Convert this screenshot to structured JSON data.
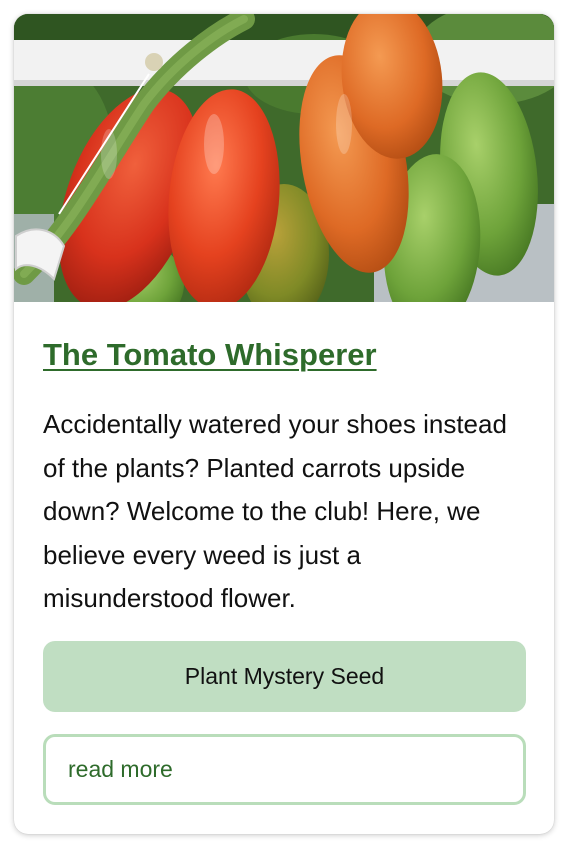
{
  "card": {
    "image_alt": "Elongated tomatoes ripening on the vine",
    "title": "The Tomato Whisperer",
    "description": "Accidentally watered your shoes instead of the plants? Planted carrots upside down? Welcome to the club! Here, we believe every weed is just a misunderstood flower.",
    "primary_button_label": "Plant Mystery Seed",
    "secondary_button_label": "read more"
  },
  "colors": {
    "title": "#2e6b2b",
    "primary_button_bg": "#c0dec2",
    "secondary_button_border": "#b9ddba",
    "secondary_button_text": "#2e6b2b"
  }
}
